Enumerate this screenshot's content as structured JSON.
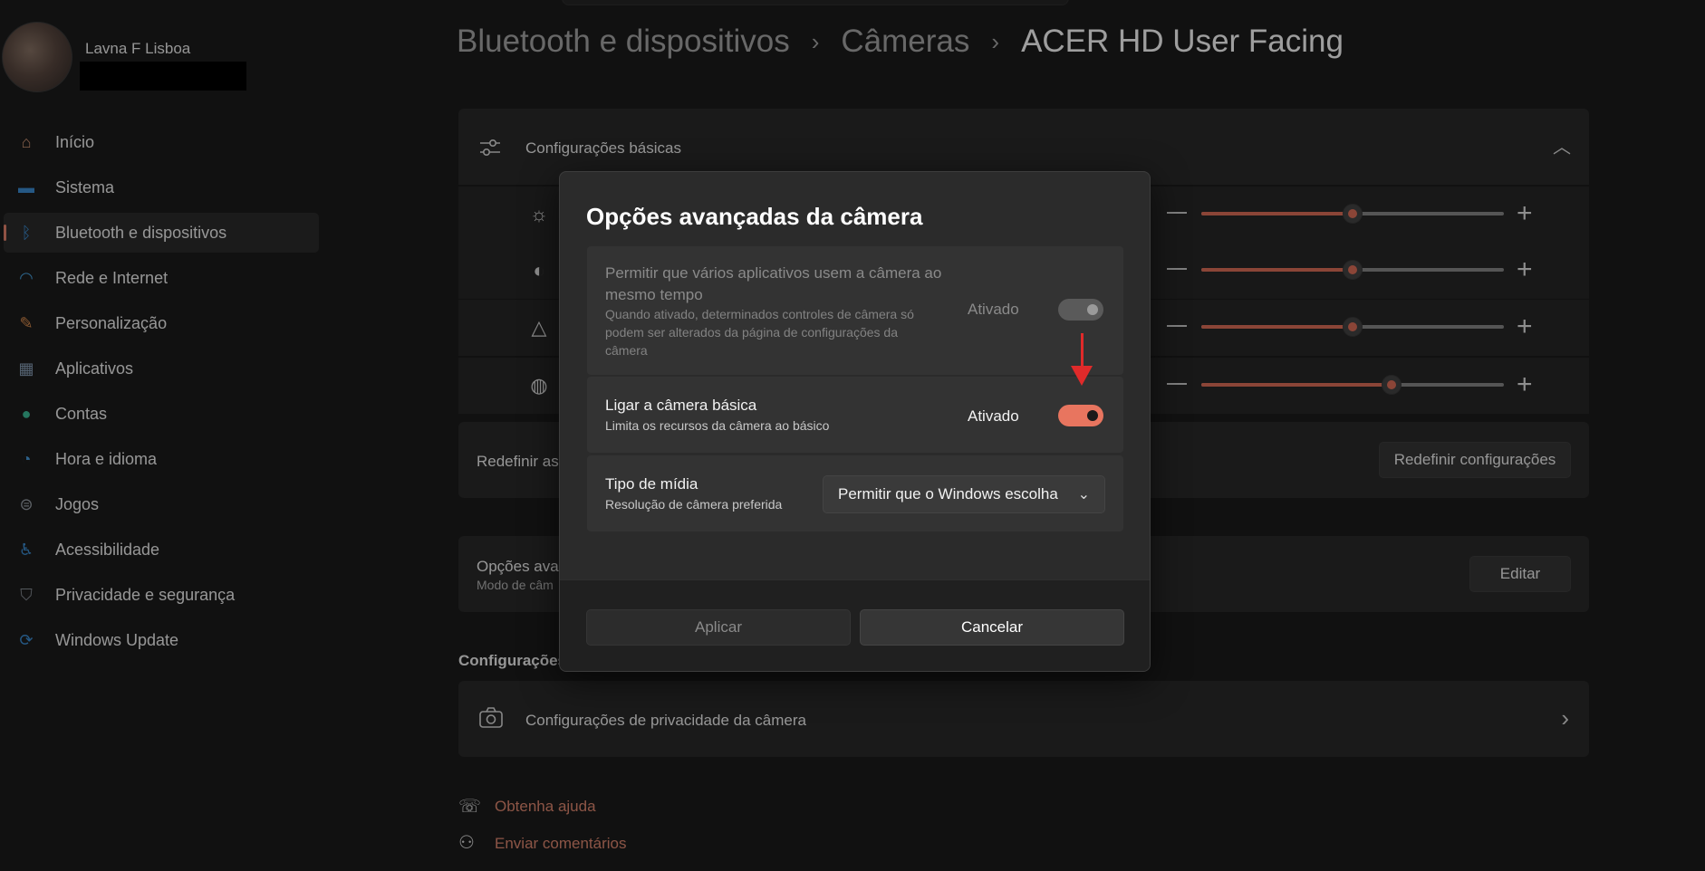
{
  "profile": {
    "name": "Lavna F Lisboa"
  },
  "sidebar": {
    "items": [
      {
        "label": "Início",
        "icon": "home-icon",
        "glyph": "⌂",
        "color": "#d99c7a"
      },
      {
        "label": "Sistema",
        "icon": "system-icon",
        "glyph": "▬",
        "color": "#3d8fd6"
      },
      {
        "label": "Bluetooth e dispositivos",
        "icon": "bluetooth-icon",
        "glyph": "ᛒ",
        "color": "#3d8fd6",
        "active": true
      },
      {
        "label": "Rede e Internet",
        "icon": "wifi-icon",
        "glyph": "◠",
        "color": "#4aa3e0"
      },
      {
        "label": "Personalização",
        "icon": "brush-icon",
        "glyph": "✎",
        "color": "#e09050"
      },
      {
        "label": "Aplicativos",
        "icon": "apps-icon",
        "glyph": "▦",
        "color": "#8aa0b8"
      },
      {
        "label": "Contas",
        "icon": "accounts-icon",
        "glyph": "●",
        "color": "#3dbf9a"
      },
      {
        "label": "Hora e idioma",
        "icon": "globe-clock-icon",
        "glyph": "◔",
        "color": "#4a9ee0"
      },
      {
        "label": "Jogos",
        "icon": "gamepad-icon",
        "glyph": "⊜",
        "color": "#9aa0a8"
      },
      {
        "label": "Acessibilidade",
        "icon": "accessibility-icon",
        "glyph": "♿",
        "color": "#3d8fd6"
      },
      {
        "label": "Privacidade e segurança",
        "icon": "shield-icon",
        "glyph": "⛉",
        "color": "#8a9098"
      },
      {
        "label": "Windows Update",
        "icon": "update-icon",
        "glyph": "⟳",
        "color": "#3d8fd6"
      }
    ]
  },
  "breadcrumb": {
    "items": [
      "Bluetooth e dispositivos",
      "Câmeras",
      "ACER HD User Facing"
    ],
    "separator": "›"
  },
  "basic_settings": {
    "title": "Configurações básicas",
    "collapse_glyph": "︿",
    "sliders": [
      {
        "name": "brightness",
        "icon": "brightness-icon",
        "glyph": "☼",
        "value": 0.5
      },
      {
        "name": "contrast",
        "icon": "contrast-icon",
        "glyph": "◐",
        "value": 0.5
      },
      {
        "name": "sharpness",
        "icon": "sharpness-icon",
        "glyph": "△",
        "value": 0.5
      },
      {
        "name": "saturation",
        "icon": "palette-icon",
        "glyph": "◍",
        "value": 0.63
      }
    ]
  },
  "reset": {
    "label": "Redefinir as",
    "button": "Redefinir configurações"
  },
  "advanced": {
    "label": "Opções ava",
    "sub": "Modo de câm",
    "button": "Editar"
  },
  "related": {
    "title": "Configurações",
    "privacy_label": "Configurações de privacidade da câmera",
    "chevron": "›"
  },
  "links": {
    "help": "Obtenha ajuda",
    "feedback": "Enviar comentários"
  },
  "dialog": {
    "title": "Opções avançadas da câmera",
    "multi_app": {
      "title_line1": "Permitir que vários aplicativos usem a câmera ao",
      "title_line2": "mesmo tempo",
      "desc_line1": "Quando ativado, determinados controles de câmera só",
      "desc_line2": "podem ser alterados da página de configurações da",
      "desc_line3": "câmera",
      "state": "Ativado",
      "enabled": false
    },
    "basic_camera": {
      "title": "Ligar a câmera básica",
      "desc": "Limita os recursos da câmera ao básico",
      "state": "Ativado",
      "on": true
    },
    "media_type": {
      "title": "Tipo de mídia",
      "desc": "Resolução de câmera preferida",
      "selected": "Permitir que o Windows escolha",
      "chevron": "⌄"
    },
    "apply": "Aplicar",
    "cancel": "Cancelar"
  },
  "colors": {
    "accent": "#e8755f",
    "annotation_arrow": "#e02a2a"
  }
}
